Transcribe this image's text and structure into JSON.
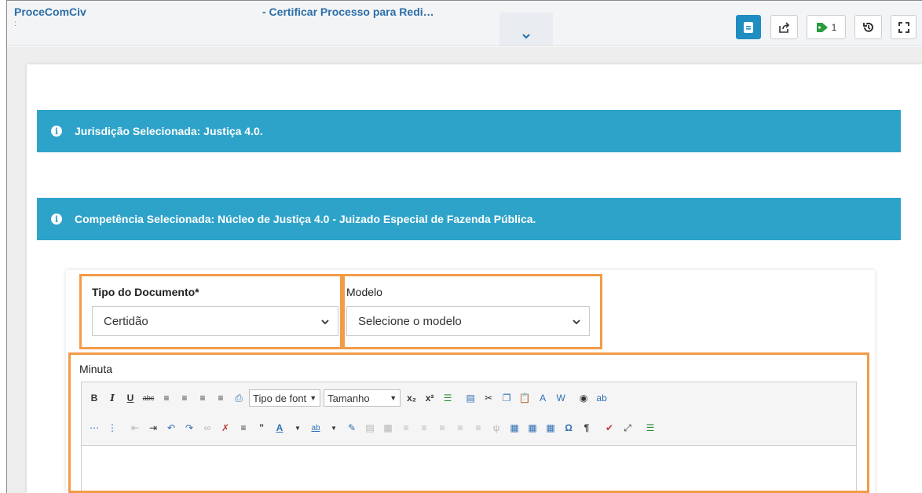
{
  "header": {
    "app_name": "ProceComCiv",
    "app_sub": ":",
    "task_title": "- Certificar Processo para Redi…",
    "tag_count": "1"
  },
  "toolbar_icons": [
    "document-icon",
    "share-icon",
    "tag-icon",
    "history-icon",
    "fullscreen-icon"
  ],
  "alerts": {
    "jurisdicao": "Jurisdição Selecionada: Justiça 4.0.",
    "competencia": "Competência Selecionada: Núcleo de Justiça 4.0 - Juizado Especial de Fazenda Pública."
  },
  "form": {
    "tipo_label": "Tipo do Documento*",
    "tipo_value": "Certidão",
    "modelo_label": "Modelo",
    "modelo_value": "Selecione o modelo",
    "minuta_label": "Minuta"
  },
  "editor": {
    "font_combo": "Tipo de font",
    "size_combo": "Tamanho",
    "bold": "B",
    "italic": "I",
    "underline": "U",
    "strike": "abc",
    "subscript": "x₂",
    "superscript": "x²",
    "omega": "Ω",
    "pilcrow": "¶",
    "quote": "”",
    "font_color": "A",
    "bg_color": "ab"
  },
  "colors": {
    "accent": "#1f8dc1",
    "info_bar": "#2ea3c9",
    "highlight": "#f29b48",
    "title_blue": "#2b6ea8"
  }
}
